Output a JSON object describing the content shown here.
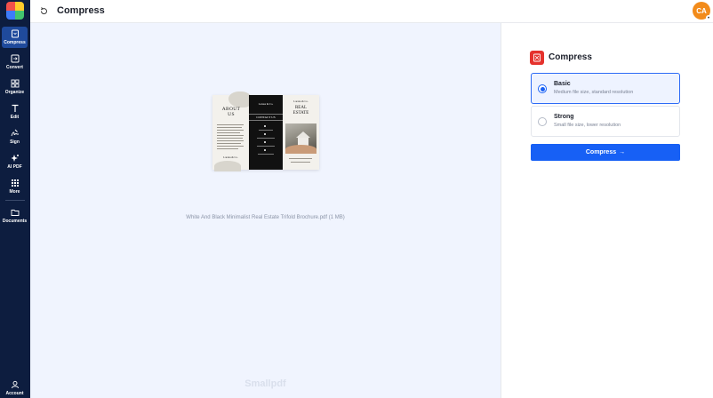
{
  "app": {
    "brand": "Smallpdf"
  },
  "sidebar": {
    "items": [
      {
        "label": "Compress",
        "icon": "compress-icon",
        "active": true
      },
      {
        "label": "Convert",
        "icon": "convert-icon"
      },
      {
        "label": "Organize",
        "icon": "organize-icon"
      },
      {
        "label": "Edit",
        "icon": "edit-text-icon"
      },
      {
        "label": "Sign",
        "icon": "signature-icon"
      },
      {
        "label": "AI PDF",
        "icon": "ai-sparkle-icon"
      },
      {
        "label": "More",
        "icon": "grid-icon"
      },
      {
        "label": "Documents",
        "icon": "folder-icon"
      }
    ],
    "account": {
      "label": "Account",
      "icon": "user-icon"
    }
  },
  "header": {
    "title": "Compress",
    "avatar_initials": "CA",
    "avatar_color": "#f28b1a"
  },
  "document": {
    "filename": "White And Black Minimalist Real Estate Trifold Brochure.pdf (1 MB)",
    "preview": {
      "panel1_heading": "ABOUT\nUS",
      "panel1_footer": "Larana & Co.",
      "panel2_brand": "Larana & Co.",
      "panel2_heading": "CONTACT US",
      "panel3_brand": "Larana & Co.",
      "panel3_heading": "REAL\nESTATE"
    }
  },
  "options_panel": {
    "title": "Compress",
    "accent": "#e5322d",
    "options": [
      {
        "title": "Basic",
        "description": "Medium file size, standard resolution",
        "selected": true
      },
      {
        "title": "Strong",
        "description": "Small file size, lower resolution",
        "selected": false
      }
    ],
    "button_label": "Compress",
    "button_arrow": "→",
    "button_color": "#1760f5"
  }
}
